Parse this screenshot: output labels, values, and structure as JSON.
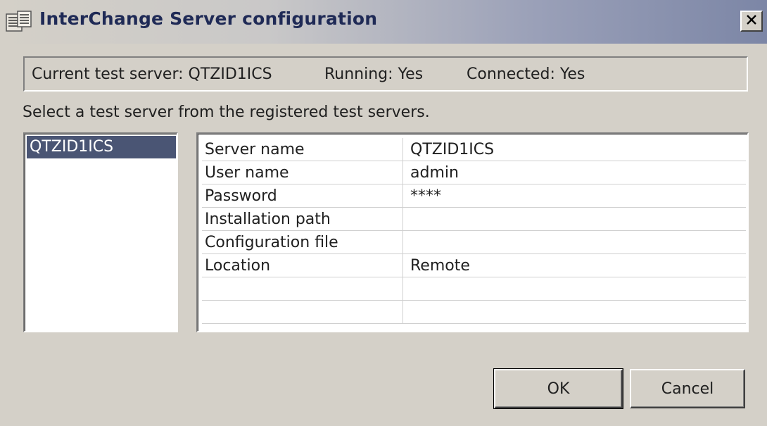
{
  "window": {
    "title": "InterChange Server configuration",
    "icon": "interchange-app-icon",
    "close_icon": "close-icon"
  },
  "status": {
    "current_server": "Current test server: QTZID1ICS",
    "running": "Running: Yes",
    "connected": "Connected: Yes"
  },
  "instruction": "Select a test server from the registered test servers.",
  "server_list": {
    "items": [
      {
        "label": "QTZID1ICS",
        "selected": true
      }
    ]
  },
  "properties": [
    {
      "key": "Server name",
      "value": "QTZID1ICS"
    },
    {
      "key": "User name",
      "value": "admin"
    },
    {
      "key": "Password",
      "value": "****"
    },
    {
      "key": "Installation path",
      "value": ""
    },
    {
      "key": "Configuration file",
      "value": ""
    },
    {
      "key": "Location",
      "value": "Remote"
    },
    {
      "key": "",
      "value": ""
    },
    {
      "key": "",
      "value": ""
    }
  ],
  "buttons": {
    "ok": "OK",
    "cancel": "Cancel"
  },
  "colors": {
    "selection": "#4a5574",
    "title_text": "#1f2a56",
    "dialog_bg": "#d4d0c8"
  }
}
